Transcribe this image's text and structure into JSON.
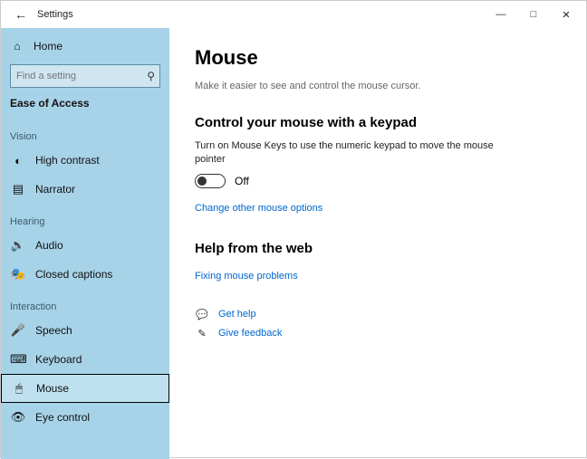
{
  "window": {
    "title": "Settings"
  },
  "sidebar": {
    "home": "Home",
    "search_placeholder": "Find a setting",
    "category": "Ease of Access",
    "groups": [
      {
        "label": "Vision",
        "items": [
          {
            "name": "high-contrast",
            "label": "High contrast"
          },
          {
            "name": "narrator",
            "label": "Narrator"
          }
        ]
      },
      {
        "label": "Hearing",
        "items": [
          {
            "name": "audio",
            "label": "Audio"
          },
          {
            "name": "closed-captions",
            "label": "Closed captions"
          }
        ]
      },
      {
        "label": "Interaction",
        "items": [
          {
            "name": "speech",
            "label": "Speech"
          },
          {
            "name": "keyboard",
            "label": "Keyboard"
          },
          {
            "name": "mouse",
            "label": "Mouse",
            "selected": true
          },
          {
            "name": "eye-control",
            "label": "Eye control"
          }
        ]
      }
    ]
  },
  "main": {
    "title": "Mouse",
    "subtitle": "Make it easier to see and control the mouse cursor.",
    "section1": {
      "heading": "Control your mouse with a keypad",
      "desc": "Turn on Mouse Keys to use the numeric keypad to move the mouse pointer",
      "toggle_state": "Off",
      "link": "Change other mouse options"
    },
    "section2": {
      "heading": "Help from the web",
      "link": "Fixing mouse problems"
    },
    "help": {
      "get_help": "Get help",
      "feedback": "Give feedback"
    }
  }
}
